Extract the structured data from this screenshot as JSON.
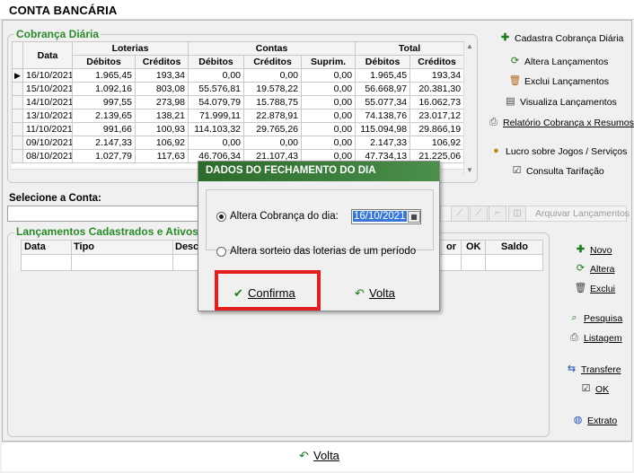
{
  "window": {
    "title": "CONTA BANCÁRIA"
  },
  "cobranca": {
    "title": "Cobrança Diária",
    "group_headers": {
      "date": "Data",
      "loterias": "Loterias",
      "contas": "Contas",
      "total": "Total"
    },
    "sub_headers": {
      "debitos": "Débitos",
      "creditos": "Créditos",
      "suprim": "Suprim."
    },
    "rows": [
      [
        "16/10/2021",
        "1.965,45",
        "193,34",
        "0,00",
        "0,00",
        "0,00",
        "1.965,45",
        "193,34"
      ],
      [
        "15/10/2021",
        "1.092,16",
        "803,08",
        "55.576,81",
        "19.578,22",
        "0,00",
        "56.668,97",
        "20.381,30"
      ],
      [
        "14/10/2021",
        "997,55",
        "273,98",
        "54.079,79",
        "15.788,75",
        "0,00",
        "55.077,34",
        "16.062,73"
      ],
      [
        "13/10/2021",
        "2.139,65",
        "138,21",
        "71.999,11",
        "22.878,91",
        "0,00",
        "74.138,76",
        "23.017,12"
      ],
      [
        "11/10/2021",
        "991,66",
        "100,93",
        "114.103,32",
        "29.765,26",
        "0,00",
        "115.094,98",
        "29.866,19"
      ],
      [
        "09/10/2021",
        "2.147,33",
        "106,92",
        "0,00",
        "0,00",
        "0,00",
        "2.147,33",
        "106,92"
      ],
      [
        "08/10/2021",
        "1.027,79",
        "117,63",
        "46.706,34",
        "21.107,43",
        "0,00",
        "47.734,13",
        "21.225,06"
      ]
    ],
    "selected_row_marker": "▶"
  },
  "side_top": {
    "cadastra": "Cadastra Cobrança Diária",
    "altera": "Altera Lançamentos",
    "exclui": "Exclui Lançamentos",
    "visualiza": "Visualiza Lançamentos",
    "relatorio": "Relatório Cobrança x Resumos",
    "lucro": "Lucro sobre Jogos / Serviços",
    "consulta": "Consulta Tarifação"
  },
  "conta": {
    "label": "Selecione a Conta:",
    "value": ""
  },
  "arquivar": "Arquivar Lançamentos",
  "lancamentos": {
    "title": "Lançamentos Cadastrados e Ativos:",
    "columns": {
      "data": "Data",
      "tipo": "Tipo",
      "desc": "Desc",
      "valor": "or",
      "ok": "OK",
      "saldo": "Saldo"
    }
  },
  "side_bottom": {
    "novo": "Novo",
    "altera": "Altera",
    "exclui": "Exclui",
    "pesquisa": "Pesquisa",
    "listagem": "Listagem",
    "transfere": "Transfere",
    "ok": "OK",
    "extrato": "Extrato"
  },
  "footer": {
    "volta": "Volta"
  },
  "dialog": {
    "title": "DADOS DO FECHAMENTO DO DIA",
    "option1": "Altera Cobrança do dia:",
    "date_value": "16/10/2021",
    "option2": "Altera sorteio das loterias de um período",
    "confirma": "Confirma",
    "volta": "Volta"
  },
  "colors": {
    "accent_green": "#2a8a2a",
    "title_green": "#2c6b2c",
    "highlight_red": "#e41e1e"
  }
}
